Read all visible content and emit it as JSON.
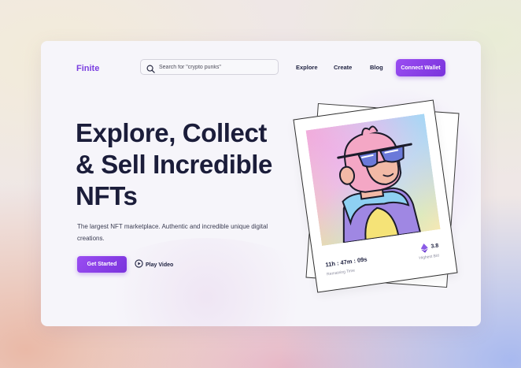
{
  "brand": {
    "logo": "Finite"
  },
  "search": {
    "placeholder": "Search for \"crypto punks\""
  },
  "nav": {
    "items": [
      "Explore",
      "Create",
      "Blog"
    ],
    "connect_label": "Connect Wallet"
  },
  "hero": {
    "headline": [
      "Explore, Collect",
      "& Sell Incredible",
      "NFTs"
    ],
    "subtitle": "The largest NFT marketplace. Authentic and incredible unique digital creations.",
    "cta_label": "Get Started",
    "play_label": "Play Video"
  },
  "nft": {
    "timer": "11h : 47m : 09s",
    "timer_label": "Remaining Time",
    "bid": "3.8",
    "bid_label": "Highest Bid"
  },
  "icons": {
    "search": "search-icon",
    "play": "play-circle-icon",
    "eth": "ethereum-icon"
  },
  "colors": {
    "accent": "#7a3ee0",
    "text": "#1b1d3a",
    "card_bg": "#f6f5fa"
  }
}
